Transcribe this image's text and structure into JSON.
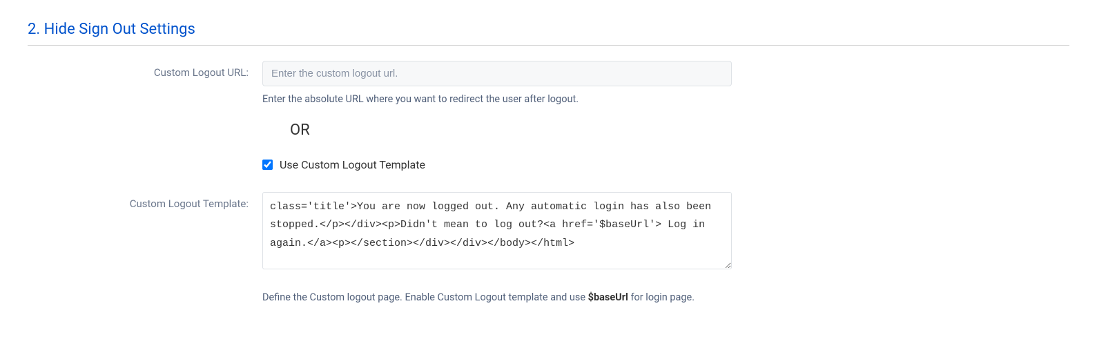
{
  "section": {
    "title": "2. Hide Sign Out Settings"
  },
  "customLogoutUrl": {
    "label": "Custom Logout URL:",
    "placeholder": "Enter the custom logout url.",
    "value": "",
    "help": "Enter the absolute URL where you want to redirect the user after logout."
  },
  "divider": {
    "text": "OR"
  },
  "useTemplateCheckbox": {
    "label": "Use Custom Logout Template",
    "checked": true
  },
  "customLogoutTemplate": {
    "label": "Custom Logout Template:",
    "value": "class='title'>You are now logged out. Any automatic login has also been stopped.</p></div><p>Didn't mean to log out?<a href='$baseUrl'> Log in again.</a><p></section></div></div></body></html>",
    "helpPrefix": "Define the Custom logout page. Enable Custom Logout template and use ",
    "helpBold": "$baseUrl",
    "helpSuffix": " for login page."
  }
}
